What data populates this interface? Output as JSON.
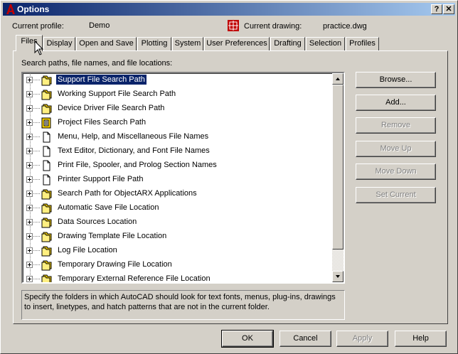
{
  "window": {
    "title": "Options",
    "help_label": "?",
    "close_label": "✕"
  },
  "profile": {
    "label": "Current profile:",
    "value": "Demo"
  },
  "drawing": {
    "label": "Current drawing:",
    "value": "practice.dwg"
  },
  "tabs": [
    {
      "label": "Files",
      "active": true
    },
    {
      "label": "Display"
    },
    {
      "label": "Open and Save"
    },
    {
      "label": "Plotting"
    },
    {
      "label": "System"
    },
    {
      "label": "User Preferences"
    },
    {
      "label": "Drafting"
    },
    {
      "label": "Selection"
    },
    {
      "label": "Profiles"
    }
  ],
  "files": {
    "heading": "Search paths, file names, and file locations:",
    "items": [
      {
        "label": "Support File Search Path",
        "icon": "folders-icon",
        "selected": true
      },
      {
        "label": "Working Support File Search Path",
        "icon": "folders-icon"
      },
      {
        "label": "Device Driver File Search Path",
        "icon": "folders-icon"
      },
      {
        "label": "Project Files Search Path",
        "icon": "project-icon"
      },
      {
        "label": "Menu, Help, and Miscellaneous File Names",
        "icon": "file-icon"
      },
      {
        "label": "Text Editor, Dictionary, and Font File Names",
        "icon": "file-icon"
      },
      {
        "label": "Print File, Spooler, and Prolog Section Names",
        "icon": "file-icon"
      },
      {
        "label": "Printer Support File Path",
        "icon": "file-icon"
      },
      {
        "label": "Search Path for ObjectARX Applications",
        "icon": "folders-icon"
      },
      {
        "label": "Automatic Save File Location",
        "icon": "folders-icon"
      },
      {
        "label": "Data Sources Location",
        "icon": "folders-icon"
      },
      {
        "label": "Drawing Template File Location",
        "icon": "folders-icon"
      },
      {
        "label": "Log File Location",
        "icon": "folders-icon"
      },
      {
        "label": "Temporary Drawing File Location",
        "icon": "folders-icon"
      },
      {
        "label": "Temporary External Reference File Location",
        "icon": "folders-icon"
      }
    ],
    "description": "Specify the folders in which AutoCAD should look for text fonts, menus, plug-ins, drawings to insert, linetypes, and hatch patterns that are not in the current folder."
  },
  "side_buttons": {
    "browse": "Browse...",
    "add": "Add...",
    "remove": "Remove",
    "move_up": "Move Up",
    "move_down": "Move Down",
    "set_current": "Set Current"
  },
  "footer_buttons": {
    "ok": "OK",
    "cancel": "Cancel",
    "apply": "Apply",
    "help": "Help"
  },
  "colors": {
    "titlebar": "#0a246a",
    "face": "#d4d0c8",
    "folder": "#ffd700"
  }
}
